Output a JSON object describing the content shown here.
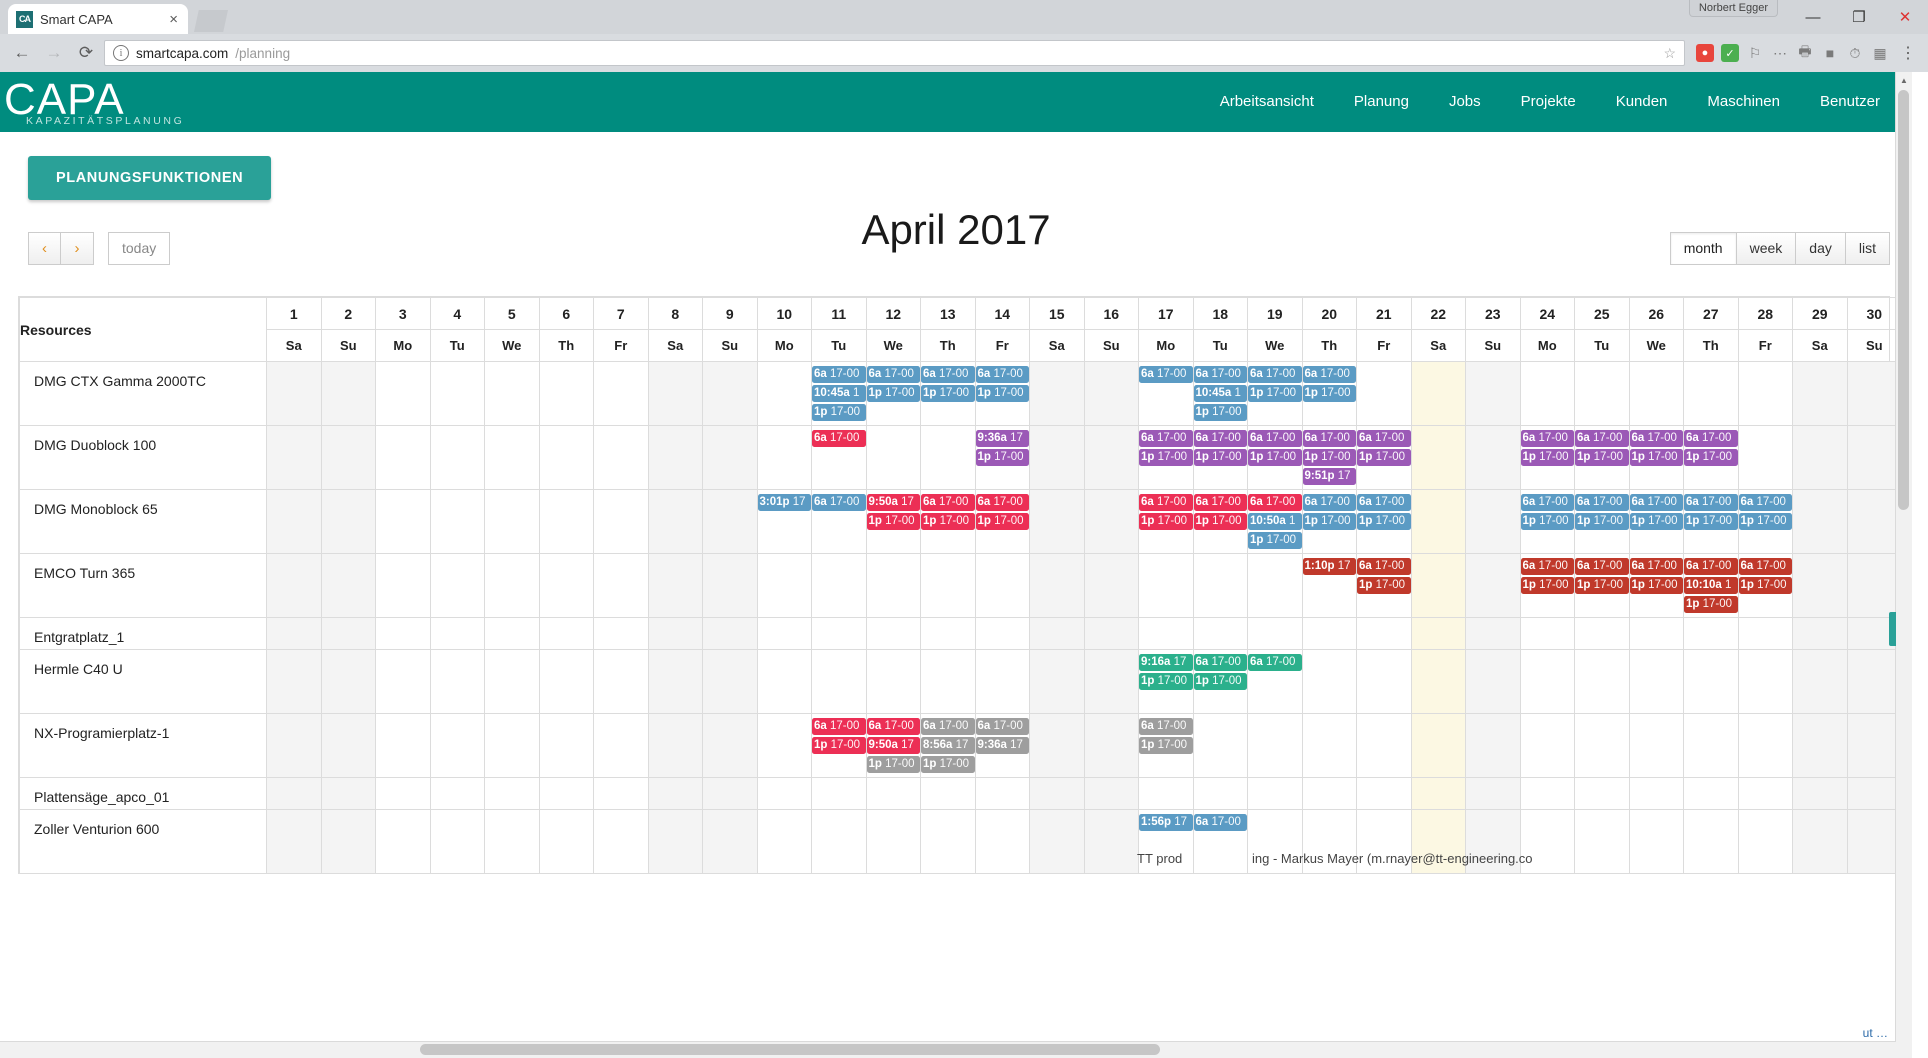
{
  "browser": {
    "tab_title": "Smart CAPA",
    "favicon_text": "CA",
    "close_tab": "×",
    "url_display": "smartcapa.com",
    "url_path": "/planning",
    "user_chip": "Norbert Egger",
    "back_icon": "←",
    "forward_icon": "→",
    "reload_icon": "⟳",
    "star_icon": "☆",
    "menu_icon": "⋮",
    "minimize": "—",
    "maximize": "❐",
    "close": "✕"
  },
  "navbar": {
    "logo_main": "CAPA",
    "logo_sub": "KAPAZITÄTSPLANUNG",
    "brand_color": "#008c7f",
    "items": [
      {
        "label": "Arbeitsansicht"
      },
      {
        "label": "Planung"
      },
      {
        "label": "Jobs"
      },
      {
        "label": "Projekte"
      },
      {
        "label": "Kunden"
      },
      {
        "label": "Maschinen"
      },
      {
        "label": "Benutzer"
      }
    ]
  },
  "toolbar": {
    "planning_functions_label": "PLANUNGSFUNKTIONEN",
    "prev_label": "‹",
    "next_label": "›",
    "today_label": "today",
    "title": "April 2017",
    "views": [
      {
        "label": "month",
        "active": true
      },
      {
        "label": "week",
        "active": false
      },
      {
        "label": "day",
        "active": false
      },
      {
        "label": "list",
        "active": false
      }
    ]
  },
  "calendar": {
    "resources_header": "Resources",
    "days": [
      {
        "n": "1",
        "dow": "Sa",
        "weekend": true,
        "today": false
      },
      {
        "n": "2",
        "dow": "Su",
        "weekend": true,
        "today": false
      },
      {
        "n": "3",
        "dow": "Mo",
        "weekend": false,
        "today": false
      },
      {
        "n": "4",
        "dow": "Tu",
        "weekend": false,
        "today": false
      },
      {
        "n": "5",
        "dow": "We",
        "weekend": false,
        "today": false
      },
      {
        "n": "6",
        "dow": "Th",
        "weekend": false,
        "today": false
      },
      {
        "n": "7",
        "dow": "Fr",
        "weekend": false,
        "today": false
      },
      {
        "n": "8",
        "dow": "Sa",
        "weekend": true,
        "today": false
      },
      {
        "n": "9",
        "dow": "Su",
        "weekend": true,
        "today": false
      },
      {
        "n": "10",
        "dow": "Mo",
        "weekend": false,
        "today": false
      },
      {
        "n": "11",
        "dow": "Tu",
        "weekend": false,
        "today": false
      },
      {
        "n": "12",
        "dow": "We",
        "weekend": false,
        "today": false
      },
      {
        "n": "13",
        "dow": "Th",
        "weekend": false,
        "today": false
      },
      {
        "n": "14",
        "dow": "Fr",
        "weekend": false,
        "today": false
      },
      {
        "n": "15",
        "dow": "Sa",
        "weekend": true,
        "today": false
      },
      {
        "n": "16",
        "dow": "Su",
        "weekend": true,
        "today": false
      },
      {
        "n": "17",
        "dow": "Mo",
        "weekend": false,
        "today": false
      },
      {
        "n": "18",
        "dow": "Tu",
        "weekend": false,
        "today": false
      },
      {
        "n": "19",
        "dow": "We",
        "weekend": false,
        "today": false
      },
      {
        "n": "20",
        "dow": "Th",
        "weekend": false,
        "today": false
      },
      {
        "n": "21",
        "dow": "Fr",
        "weekend": false,
        "today": false
      },
      {
        "n": "22",
        "dow": "Sa",
        "weekend": true,
        "today": true
      },
      {
        "n": "23",
        "dow": "Su",
        "weekend": true,
        "today": false
      },
      {
        "n": "24",
        "dow": "Mo",
        "weekend": false,
        "today": false
      },
      {
        "n": "25",
        "dow": "Tu",
        "weekend": false,
        "today": false
      },
      {
        "n": "26",
        "dow": "We",
        "weekend": false,
        "today": false
      },
      {
        "n": "27",
        "dow": "Th",
        "weekend": false,
        "today": false
      },
      {
        "n": "28",
        "dow": "Fr",
        "weekend": false,
        "today": false
      },
      {
        "n": "29",
        "dow": "Sa",
        "weekend": true,
        "today": false
      },
      {
        "n": "30",
        "dow": "Su",
        "weekend": true,
        "today": false
      }
    ],
    "event_colors": {
      "blue": "#5b9bc4",
      "red": "#ec2f55",
      "purple": "#9b59b6",
      "brick": "#c0392b",
      "green": "#2bb08c",
      "gray": "#9e9e9e"
    },
    "rows": [
      {
        "resource": "DMG CTX Gamma 2000TC",
        "height": "row-h-3",
        "events": {
          "11": [
            {
              "t": "6a",
              "j": "17-00",
              "c": "blue"
            },
            {
              "t": "10:45a",
              "j": "1",
              "c": "blue"
            },
            {
              "t": "1p",
              "j": "17-00",
              "c": "blue"
            }
          ],
          "12": [
            {
              "t": "6a",
              "j": "17-00",
              "c": "blue"
            },
            {
              "t": "1p",
              "j": "17-00",
              "c": "blue"
            }
          ],
          "13": [
            {
              "t": "6a",
              "j": "17-00",
              "c": "blue"
            },
            {
              "t": "1p",
              "j": "17-00",
              "c": "blue"
            }
          ],
          "14": [
            {
              "t": "6a",
              "j": "17-00",
              "c": "blue"
            },
            {
              "t": "1p",
              "j": "17-00",
              "c": "blue"
            }
          ],
          "17": [
            {
              "t": "6a",
              "j": "17-00",
              "c": "blue"
            }
          ],
          "18": [
            {
              "t": "6a",
              "j": "17-00",
              "c": "blue"
            },
            {
              "t": "10:45a",
              "j": "1",
              "c": "blue"
            },
            {
              "t": "1p",
              "j": "17-00",
              "c": "blue"
            }
          ],
          "19": [
            {
              "t": "6a",
              "j": "17-00",
              "c": "blue"
            },
            {
              "t": "1p",
              "j": "17-00",
              "c": "blue"
            }
          ],
          "20": [
            {
              "t": "6a",
              "j": "17-00",
              "c": "blue"
            },
            {
              "t": "1p",
              "j": "17-00",
              "c": "blue"
            }
          ]
        }
      },
      {
        "resource": "DMG Duoblock 100",
        "height": "row-h-3",
        "events": {
          "11": [
            {
              "t": "6a",
              "j": "17-00",
              "c": "red"
            }
          ],
          "14": [
            {
              "t": "9:36a",
              "j": "17",
              "c": "purple"
            },
            {
              "t": "1p",
              "j": "17-00",
              "c": "purple"
            }
          ],
          "17": [
            {
              "t": "6a",
              "j": "17-00",
              "c": "purple"
            },
            {
              "t": "1p",
              "j": "17-00",
              "c": "purple"
            }
          ],
          "18": [
            {
              "t": "6a",
              "j": "17-00",
              "c": "purple"
            },
            {
              "t": "1p",
              "j": "17-00",
              "c": "purple"
            }
          ],
          "19": [
            {
              "t": "6a",
              "j": "17-00",
              "c": "purple"
            },
            {
              "t": "1p",
              "j": "17-00",
              "c": "purple"
            }
          ],
          "20": [
            {
              "t": "6a",
              "j": "17-00",
              "c": "purple"
            },
            {
              "t": "1p",
              "j": "17-00",
              "c": "purple"
            },
            {
              "t": "9:51p",
              "j": "17",
              "c": "purple"
            }
          ],
          "21": [
            {
              "t": "6a",
              "j": "17-00",
              "c": "purple"
            },
            {
              "t": "1p",
              "j": "17-00",
              "c": "purple"
            }
          ],
          "24": [
            {
              "t": "6a",
              "j": "17-00",
              "c": "purple"
            },
            {
              "t": "1p",
              "j": "17-00",
              "c": "purple"
            }
          ],
          "25": [
            {
              "t": "6a",
              "j": "17-00",
              "c": "purple"
            },
            {
              "t": "1p",
              "j": "17-00",
              "c": "purple"
            }
          ],
          "26": [
            {
              "t": "6a",
              "j": "17-00",
              "c": "purple"
            },
            {
              "t": "1p",
              "j": "17-00",
              "c": "purple"
            }
          ],
          "27": [
            {
              "t": "6a",
              "j": "17-00",
              "c": "purple"
            },
            {
              "t": "1p",
              "j": "17-00",
              "c": "purple"
            }
          ]
        }
      },
      {
        "resource": "DMG Monoblock 65",
        "height": "row-h-3",
        "events": {
          "10": [
            {
              "t": "3:01p",
              "j": "17",
              "c": "blue"
            }
          ],
          "11": [
            {
              "t": "6a",
              "j": "17-00",
              "c": "blue"
            }
          ],
          "12": [
            {
              "t": "9:50a",
              "j": "17",
              "c": "red"
            },
            {
              "t": "1p",
              "j": "17-00",
              "c": "red"
            }
          ],
          "13": [
            {
              "t": "6a",
              "j": "17-00",
              "c": "red"
            },
            {
              "t": "1p",
              "j": "17-00",
              "c": "red"
            }
          ],
          "14": [
            {
              "t": "6a",
              "j": "17-00",
              "c": "red"
            },
            {
              "t": "1p",
              "j": "17-00",
              "c": "red"
            }
          ],
          "17": [
            {
              "t": "6a",
              "j": "17-00",
              "c": "red"
            },
            {
              "t": "1p",
              "j": "17-00",
              "c": "red"
            }
          ],
          "18": [
            {
              "t": "6a",
              "j": "17-00",
              "c": "red"
            },
            {
              "t": "1p",
              "j": "17-00",
              "c": "red"
            }
          ],
          "19": [
            {
              "t": "6a",
              "j": "17-00",
              "c": "red"
            },
            {
              "t": "10:50a",
              "j": "1",
              "c": "blue"
            },
            {
              "t": "1p",
              "j": "17-00",
              "c": "blue"
            }
          ],
          "20": [
            {
              "t": "6a",
              "j": "17-00",
              "c": "blue"
            },
            {
              "t": "1p",
              "j": "17-00",
              "c": "blue"
            }
          ],
          "21": [
            {
              "t": "6a",
              "j": "17-00",
              "c": "blue"
            },
            {
              "t": "1p",
              "j": "17-00",
              "c": "blue"
            }
          ],
          "24": [
            {
              "t": "6a",
              "j": "17-00",
              "c": "blue"
            },
            {
              "t": "1p",
              "j": "17-00",
              "c": "blue"
            }
          ],
          "25": [
            {
              "t": "6a",
              "j": "17-00",
              "c": "blue"
            },
            {
              "t": "1p",
              "j": "17-00",
              "c": "blue"
            }
          ],
          "26": [
            {
              "t": "6a",
              "j": "17-00",
              "c": "blue"
            },
            {
              "t": "1p",
              "j": "17-00",
              "c": "blue"
            }
          ],
          "27": [
            {
              "t": "6a",
              "j": "17-00",
              "c": "blue"
            },
            {
              "t": "1p",
              "j": "17-00",
              "c": "blue"
            }
          ],
          "28": [
            {
              "t": "6a",
              "j": "17-00",
              "c": "blue"
            },
            {
              "t": "1p",
              "j": "17-00",
              "c": "blue"
            }
          ]
        }
      },
      {
        "resource": "EMCO Turn 365",
        "height": "row-h-3",
        "events": {
          "20": [
            {
              "t": "1:10p",
              "j": "17",
              "c": "brick"
            }
          ],
          "21": [
            {
              "t": "6a",
              "j": "17-00",
              "c": "brick"
            },
            {
              "t": "1p",
              "j": "17-00",
              "c": "brick"
            }
          ],
          "24": [
            {
              "t": "6a",
              "j": "17-00",
              "c": "brick"
            },
            {
              "t": "1p",
              "j": "17-00",
              "c": "brick"
            }
          ],
          "25": [
            {
              "t": "6a",
              "j": "17-00",
              "c": "brick"
            },
            {
              "t": "1p",
              "j": "17-00",
              "c": "brick"
            }
          ],
          "26": [
            {
              "t": "6a",
              "j": "17-00",
              "c": "brick"
            },
            {
              "t": "1p",
              "j": "17-00",
              "c": "brick"
            }
          ],
          "27": [
            {
              "t": "6a",
              "j": "17-00",
              "c": "brick"
            },
            {
              "t": "10:10a",
              "j": "1",
              "c": "brick"
            },
            {
              "t": "1p",
              "j": "17-00",
              "c": "brick"
            }
          ],
          "28": [
            {
              "t": "6a",
              "j": "17-00",
              "c": "brick"
            },
            {
              "t": "1p",
              "j": "17-00",
              "c": "brick"
            }
          ]
        }
      },
      {
        "resource": "Entgratplatz_1",
        "height": "row-h-1",
        "events": {}
      },
      {
        "resource": "Hermle C40 U",
        "height": "row-h-2",
        "events": {
          "17": [
            {
              "t": "9:16a",
              "j": "17",
              "c": "green"
            },
            {
              "t": "1p",
              "j": "17-00",
              "c": "green"
            }
          ],
          "18": [
            {
              "t": "6a",
              "j": "17-00",
              "c": "green"
            },
            {
              "t": "1p",
              "j": "17-00",
              "c": "green"
            }
          ],
          "19": [
            {
              "t": "6a",
              "j": "17-00",
              "c": "green"
            }
          ]
        }
      },
      {
        "resource": "NX-Programierplatz-1",
        "height": "row-h-3",
        "events": {
          "11": [
            {
              "t": "6a",
              "j": "17-00",
              "c": "red"
            },
            {
              "t": "1p",
              "j": "17-00",
              "c": "red"
            }
          ],
          "12": [
            {
              "t": "6a",
              "j": "17-00",
              "c": "red"
            },
            {
              "t": "9:50a",
              "j": "17",
              "c": "red"
            },
            {
              "t": "1p",
              "j": "17-00",
              "c": "gray"
            }
          ],
          "13": [
            {
              "t": "6a",
              "j": "17-00",
              "c": "gray"
            },
            {
              "t": "8:56a",
              "j": "17",
              "c": "gray"
            },
            {
              "t": "1p",
              "j": "17-00",
              "c": "gray"
            }
          ],
          "14": [
            {
              "t": "6a",
              "j": "17-00",
              "c": "gray"
            },
            {
              "t": "9:36a",
              "j": "17",
              "c": "gray"
            }
          ],
          "17": [
            {
              "t": "6a",
              "j": "17-00",
              "c": "gray"
            },
            {
              "t": "1p",
              "j": "17-00",
              "c": "gray"
            }
          ]
        }
      },
      {
        "resource": "Plattensäge_apco_01",
        "height": "row-h-1",
        "events": {}
      },
      {
        "resource": "Zoller Venturion 600",
        "height": "row-h-2",
        "events": {
          "17": [
            {
              "t": "1:56p",
              "j": "17",
              "c": "blue"
            }
          ],
          "18": [
            {
              "t": "6a",
              "j": "17-00",
              "c": "blue"
            }
          ]
        }
      }
    ],
    "footer_left": "TT prod",
    "footer_right": "ing - Markus Mayer (m.rnayer@tt-engineering.co"
  },
  "statusbar": {
    "link_text": "ut …"
  }
}
